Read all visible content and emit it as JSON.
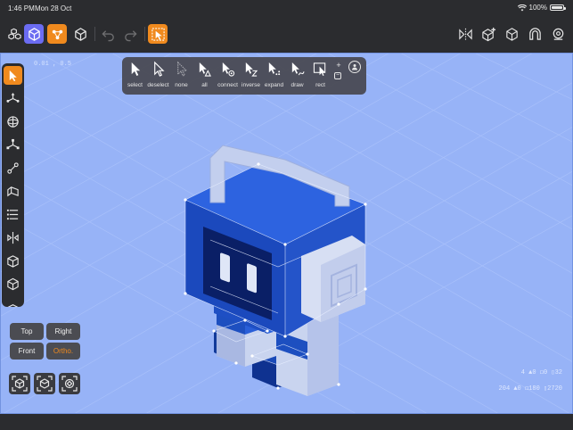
{
  "status_bar": {
    "time": "1:46 PM",
    "date": "Mon 28 Oct",
    "battery_text": "100%",
    "battery_level": 1.0
  },
  "toolbar": {
    "left_icons": [
      "scene-objects-icon",
      "object-mode-icon",
      "vertex-mode-icon",
      "solid-cube-icon",
      "undo-icon",
      "redo-icon",
      "selection-tool-icon"
    ],
    "right_icons": [
      "mirror-icon",
      "add-primitive-icon",
      "wireframe-cube-icon",
      "magnet-icon",
      "settings-icon"
    ]
  },
  "viewport": {
    "coordinates": "0.01 , 0.5",
    "background": "#97b3f7"
  },
  "left_tools": [
    "select-arrow-icon",
    "move-icon",
    "rotate-icon",
    "scale-icon",
    "extrude-icon",
    "bevel-icon",
    "loop-cut-icon",
    "mirror-axis-icon",
    "box-icon",
    "cube-icon",
    "more-icon"
  ],
  "selection_panel": {
    "items": [
      {
        "label": "select"
      },
      {
        "label": "deselect"
      },
      {
        "label": "none"
      },
      {
        "label": "all"
      },
      {
        "label": "connect"
      },
      {
        "label": "inverse"
      },
      {
        "label": "expand"
      },
      {
        "label": "draw"
      },
      {
        "label": "rect"
      }
    ],
    "plus": "+",
    "minus": "−"
  },
  "view_buttons": {
    "top": "Top",
    "right": "Right",
    "front": "Front",
    "ortho": "Ortho."
  },
  "camera_buttons": [
    "camera-focus-icon",
    "camera-perspective-icon",
    "camera-reset-icon"
  ],
  "stats": {
    "line1": "4 ▲0 ◻0 ▯32",
    "line2": "204 ▲0 ◻180 ▯2720"
  },
  "colors": {
    "accent": "#f08a1e",
    "object_mode": "#6b6cf2",
    "chrome": "#2b2c2f",
    "viewport": "#97b3f7"
  }
}
